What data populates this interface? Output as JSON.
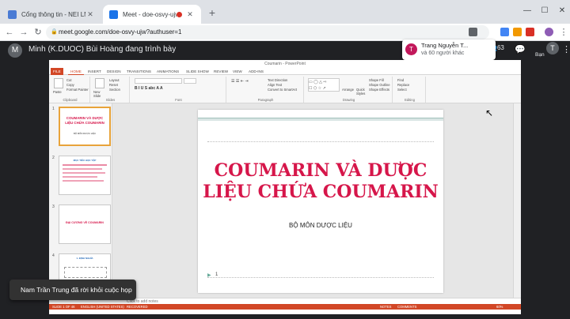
{
  "browser": {
    "tabs": [
      {
        "label": "Cổng thông tin - NEI LMS",
        "favicon_color": "#4a7bd4",
        "active": false
      },
      {
        "label": "Meet - doe-osvy-ujw",
        "favicon_color": "#1a73e8",
        "active": true
      }
    ],
    "new_tab": "+",
    "window_controls": {
      "minimize": "—",
      "maximize": "☐",
      "close": "✕"
    },
    "url": "meet.google.com/doe-osvy-ujw?authuser=1",
    "nav": {
      "back": "←",
      "forward": "→",
      "reload": "↻"
    }
  },
  "meet": {
    "presenter_initial": "M",
    "presenter_text": "Minh (K.DUOC) Bùi Hoàng đang trình bày",
    "join_chip": {
      "initial": "T",
      "name": "Trang Nguyễn T...",
      "detail": "và 60 người khác"
    },
    "participant_count": "63",
    "self_initial": "T",
    "self_label": "Bạn",
    "toast": "Nam Trần Trung đã rời khỏi cuộc họp"
  },
  "ppt": {
    "title": "Coumarin - PowerPoint",
    "user": "Minh Bu",
    "ribbon_tabs": [
      "FILE",
      "HOME",
      "INSERT",
      "DESIGN",
      "TRANSITIONS",
      "ANIMATIONS",
      "SLIDE SHOW",
      "REVIEW",
      "VIEW",
      "ADD-INS"
    ],
    "clipboard": {
      "paste": "Paste",
      "cut": "Cut",
      "copy": "Copy",
      "format": "Format Painter",
      "label": "Clipboard"
    },
    "slides_group": {
      "new": "New Slide",
      "layout": "Layout",
      "reset": "Reset",
      "section": "Section",
      "label": "Slides"
    },
    "font_label": "Font",
    "paragraph": {
      "text_direction": "Text Direction",
      "align_text": "Align Text",
      "smartart": "Convert to SmartArt",
      "label": "Paragraph"
    },
    "drawing": {
      "arrange": "Arrange",
      "quick_styles": "Quick Styles",
      "fill": "Shape Fill",
      "outline": "Shape Outline",
      "effects": "Shape Effects",
      "label": "Drawing"
    },
    "editing": {
      "find": "Find",
      "replace": "Replace",
      "select": "Select",
      "label": "Editing"
    },
    "thumbnails": [
      {
        "num": "1",
        "title": "COUMARIN VÀ DƯỢC LIỆU CHỨA COUMARIN",
        "sub": "BỘ MÔN DƯỢC LIỆU"
      },
      {
        "num": "2",
        "title": "MỤC TIÊU HỌC TẬP"
      },
      {
        "num": "3",
        "title": "ĐẠI CƯƠNG VỀ COUMARIN"
      },
      {
        "num": "4",
        "title": "1. ĐỊNH NGHĨA"
      }
    ],
    "slide": {
      "title_line1": "COUMARIN VÀ DƯỢC",
      "title_line2": "LIỆU CHỨA COUMARIN",
      "subtitle": "BỘ MÔN DƯỢC LIỆU",
      "number": "1"
    },
    "notes": "Click to add notes",
    "status": {
      "slide": "SLIDE 1 OF 46",
      "language": "ENGLISH (UNITED STATES)",
      "recovered": "RECOVERED",
      "notes": "NOTES",
      "comments": "COMMENTS",
      "zoom": "60%"
    }
  }
}
